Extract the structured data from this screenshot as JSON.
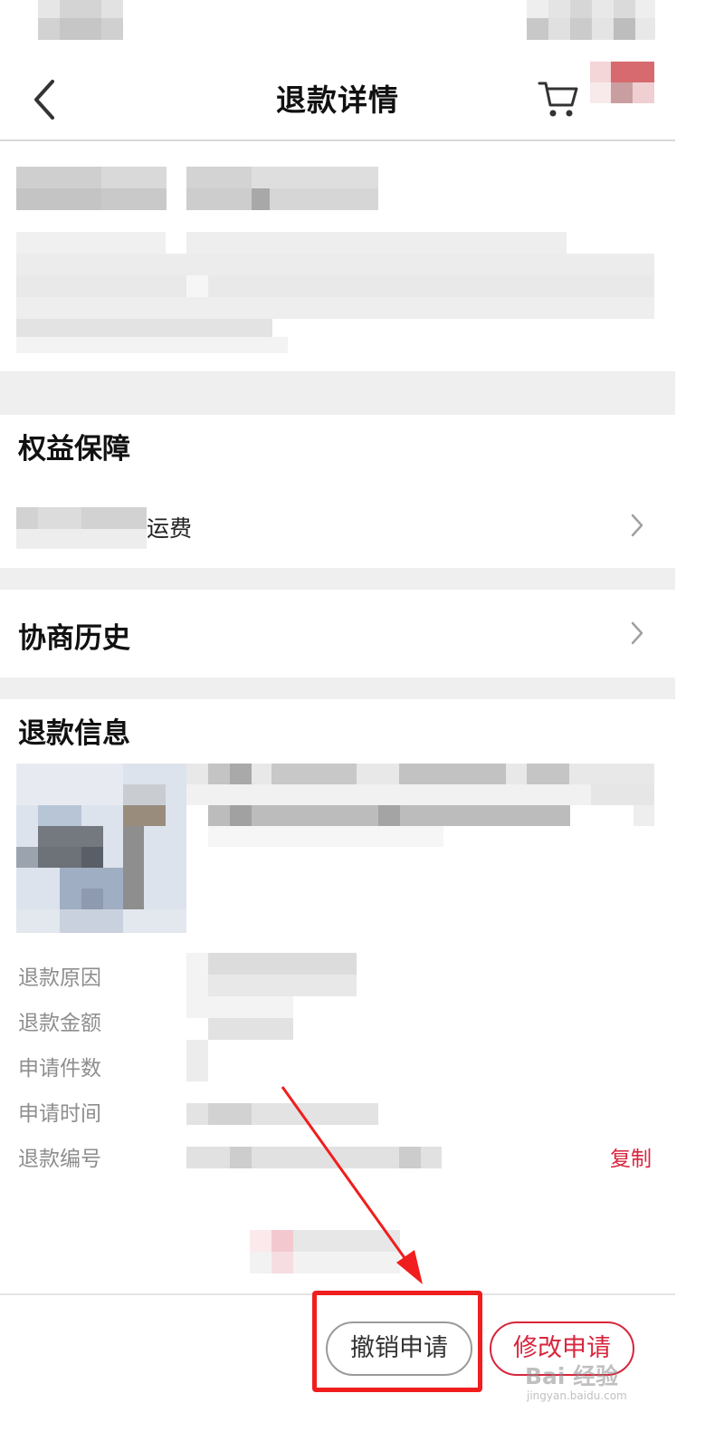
{
  "header": {
    "title": "退款详情"
  },
  "protection": {
    "title": "权益保障",
    "item_suffix": "运费"
  },
  "history": {
    "title": "协商历史"
  },
  "refund_info": {
    "title": "退款信息",
    "labels": [
      "退款原因",
      "退款金额",
      "申请件数",
      "申请时间",
      "退款编号"
    ],
    "copy_label": "复制"
  },
  "actions": {
    "cancel_label": "撤销申请",
    "modify_label": "修改申请"
  },
  "watermark": {
    "brand": "Bai 经验",
    "url": "jingyan.baidu.com"
  },
  "colors": {
    "accent": "#d7263d",
    "annotation": "#f01e1e",
    "gap": "#efefef"
  }
}
